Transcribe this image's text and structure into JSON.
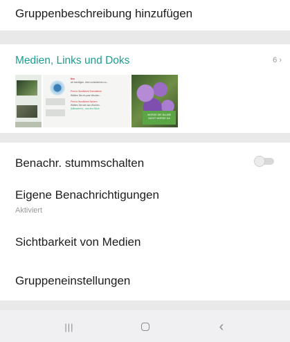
{
  "rows": {
    "add_description": "Gruppenbeschreibung hinzufügen",
    "mute": "Benachr. stummschalten",
    "custom_notifications": "Eigene Benachrichtigungen",
    "custom_notifications_status": "Aktiviert",
    "media_visibility": "Sichtbarkeit von Medien",
    "group_settings": "Gruppeneinstellungen"
  },
  "media": {
    "title": "Medien, Links und Doks",
    "count": "6",
    "count_chevron": "›",
    "thumbnails": [
      {
        "lines": [
          "Neu",
          "wir benötigen. Jetzt zurückkehren zu...",
          "Print to WordWorld Formatieren",
          "Wählen Sie ein paar Wochen...",
          "Print to WordWorld Sichern",
          "Wählen Sie sich aus Wochen...",
          "(Mitmachen)... aus den Stück"
        ]
      },
      {
        "banner": "WÜRDE DIE BLUME\nNICHT WÜRDE DA"
      }
    ]
  },
  "toggle": {
    "mute_enabled": false
  },
  "navbar": {
    "recents_glyph": "|||",
    "home_glyph": "○",
    "back_glyph": "‹"
  },
  "colors": {
    "accent": "#1b9e8f",
    "separator": "#e9e9ea",
    "navbar": "#f0f0f2"
  }
}
